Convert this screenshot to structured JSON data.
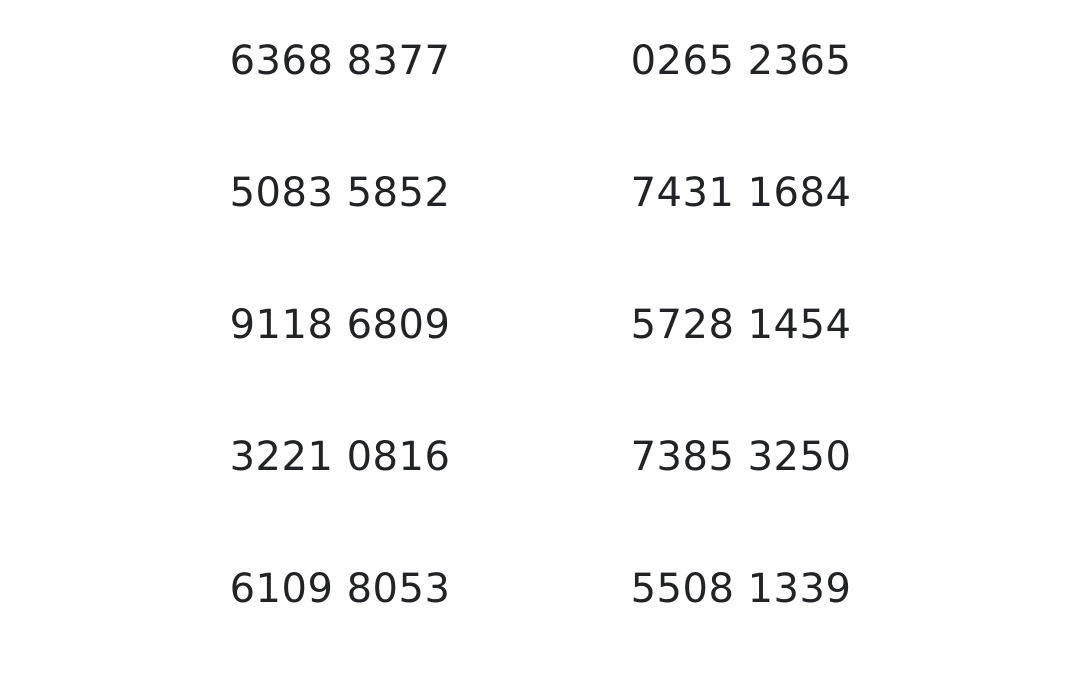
{
  "codes": {
    "rows": [
      {
        "left": "6368 8377",
        "right": "0265 2365"
      },
      {
        "left": "5083 5852",
        "right": "7431 1684"
      },
      {
        "left": "9118 6809",
        "right": "5728 1454"
      },
      {
        "left": "3221 0816",
        "right": "7385 3250"
      },
      {
        "left": "6109 8053",
        "right": "5508 1339"
      }
    ]
  },
  "colors": {
    "text": "#212326",
    "background": "#ffffff"
  }
}
